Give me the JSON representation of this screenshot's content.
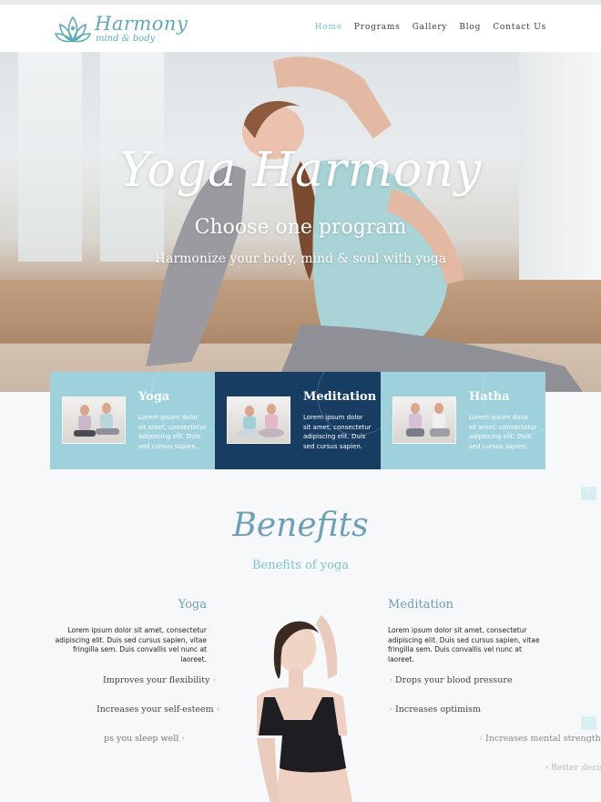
{
  "brand": {
    "title": "Harmony",
    "subtitle": "mind & body",
    "accent": "#7cc4cf",
    "icon": "lotus-logo-icon"
  },
  "nav": [
    {
      "label": "Home",
      "active": true
    },
    {
      "label": "Programs",
      "active": false
    },
    {
      "label": "Gallery",
      "active": false
    },
    {
      "label": "Blog",
      "active": false
    },
    {
      "label": "Contact Us",
      "active": false
    }
  ],
  "hero": {
    "title": "Yoga Harmony",
    "subtitle": "Choose one program",
    "tagline": "Harmonize your body, mind & soul with yoga"
  },
  "programs": [
    {
      "title": "Yoga",
      "text": "Lorem ipsum dolor sit amet, consectetur adipiscing elit. Duis sed cursus sapien.",
      "color": "#9ed1dc"
    },
    {
      "title": "Meditation",
      "text": "Lorem ipsum dolor sit amet, consectetur adipiscing elit. Duis sed cursus sapien.",
      "color": "#173d62"
    },
    {
      "title": "Hatha",
      "text": "Lorem ipsum dolor sit amet, consectetur adipiscing elit. Duis sed cursus sapien.",
      "color": "#9ed1dc"
    }
  ],
  "benefits": {
    "title": "Benefits",
    "subtitle": "Benefits of yoga",
    "left": {
      "heading": "Yoga",
      "text": "Lorem ipsum dolor sit amet, consectetur adipiscing elit. Duis sed cursus sapien, vitae fringilla sem. Duis convallis vel nunc at laoreet.",
      "features": [
        "Improves your flexibility",
        "Increases your self-esteem",
        "ps you sleep well"
      ]
    },
    "right": {
      "heading": "Meditation",
      "text": "Lorem ipsum dolor sit amet, consectetur adipiscing elit. Duis sed cursus sapien, vitae fringilla sem. Duis convallis vel nunc at laoreet.",
      "features": [
        "Drops your blood pressure",
        "Increases optimism",
        "Increases mental strength",
        "Better decisi"
      ]
    }
  }
}
